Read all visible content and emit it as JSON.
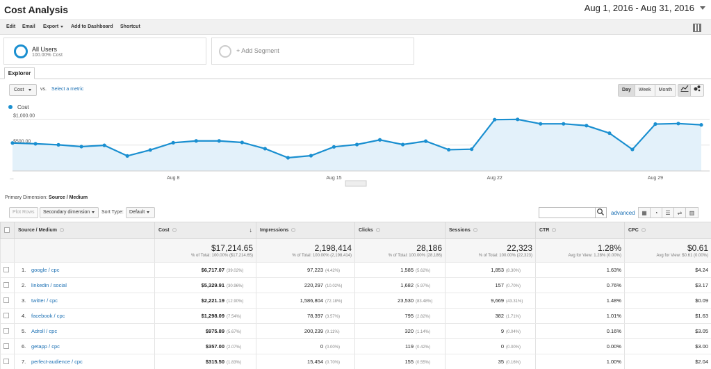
{
  "header": {
    "title": "Cost Analysis",
    "date_range": "Aug 1, 2016 - Aug 31, 2016"
  },
  "toolbar": {
    "edit": "Edit",
    "email": "Email",
    "export": "Export",
    "add_to_dashboard": "Add to Dashboard",
    "shortcut": "Shortcut"
  },
  "segments": {
    "all_users_name": "All Users",
    "all_users_sub": "100.00% Cost",
    "add_segment": "+ Add Segment"
  },
  "tabs": {
    "explorer": "Explorer"
  },
  "chart_controls": {
    "metric": "Cost",
    "vs": "vs.",
    "select_metric": "Select a metric",
    "time_buttons": [
      "Day",
      "Week",
      "Month"
    ],
    "active_time": "Day"
  },
  "chart_data": {
    "type": "area",
    "series": [
      {
        "name": "Cost",
        "values": [
          540,
          525,
          505,
          470,
          495,
          290,
          405,
          545,
          580,
          580,
          550,
          430,
          255,
          295,
          465,
          510,
          600,
          510,
          575,
          410,
          420,
          990,
          995,
          910,
          910,
          875,
          730,
          415,
          905,
          915,
          890
        ]
      }
    ],
    "x": [
      "Aug 1",
      "Aug 2",
      "Aug 3",
      "Aug 4",
      "Aug 5",
      "Aug 6",
      "Aug 7",
      "Aug 8",
      "Aug 9",
      "Aug 10",
      "Aug 11",
      "Aug 12",
      "Aug 13",
      "Aug 14",
      "Aug 15",
      "Aug 16",
      "Aug 17",
      "Aug 18",
      "Aug 19",
      "Aug 20",
      "Aug 21",
      "Aug 22",
      "Aug 23",
      "Aug 24",
      "Aug 25",
      "Aug 26",
      "Aug 27",
      "Aug 28",
      "Aug 29",
      "Aug 30",
      "Aug 31"
    ],
    "x_tick_labels": [
      "...",
      "Aug 8",
      "Aug 15",
      "Aug 22",
      "Aug 29"
    ],
    "y_tick_labels": [
      "$1,000.00",
      "$500.00"
    ],
    "ylim": [
      0,
      1100
    ],
    "color": "#1a8fd0",
    "fill": "#e3f1fa",
    "grid": true
  },
  "primary_dimension": {
    "label": "Primary Dimension:",
    "value": "Source / Medium"
  },
  "table_controls": {
    "plot_rows": "Plot Rows",
    "secondary_dimension": "Secondary dimension",
    "sort_type_label": "Sort Type:",
    "sort_type": "Default",
    "advanced": "advanced"
  },
  "table": {
    "headers": [
      "Source / Medium",
      "Cost",
      "Impressions",
      "Clicks",
      "Sessions",
      "CTR",
      "CPC"
    ],
    "totals": [
      {
        "big": "$17,214.65",
        "small": "% of Total: 100.00% ($17,214.65)"
      },
      {
        "big": "2,198,414",
        "small": "% of Total: 100.00% (2,198,414)"
      },
      {
        "big": "28,186",
        "small": "% of Total: 100.00% (28,186)"
      },
      {
        "big": "22,323",
        "small": "% of Total: 100.00% (22,323)"
      },
      {
        "big": "1.28%",
        "small": "Avg for View: 1.28% (0.00%)"
      },
      {
        "big": "$0.61",
        "small": "Avg for View: $0.61 (0.00%)"
      }
    ],
    "rows": [
      {
        "idx": "1.",
        "source": "google / cpc",
        "cost": "$6,717.07",
        "cost_pct": "(39.02%)",
        "impr": "97,223",
        "impr_pct": "(4.42%)",
        "clicks": "1,585",
        "clicks_pct": "(5.62%)",
        "sessions": "1,853",
        "sessions_pct": "(8.30%)",
        "ctr": "1.63%",
        "cpc": "$4.24"
      },
      {
        "idx": "2.",
        "source": "linkedin / social",
        "cost": "$5,329.91",
        "cost_pct": "(30.96%)",
        "impr": "220,297",
        "impr_pct": "(10.02%)",
        "clicks": "1,682",
        "clicks_pct": "(5.97%)",
        "sessions": "157",
        "sessions_pct": "(0.70%)",
        "ctr": "0.76%",
        "cpc": "$3.17"
      },
      {
        "idx": "3.",
        "source": "twitter / cpc",
        "cost": "$2,221.19",
        "cost_pct": "(12.90%)",
        "impr": "1,586,804",
        "impr_pct": "(72.18%)",
        "clicks": "23,530",
        "clicks_pct": "(83.48%)",
        "sessions": "9,669",
        "sessions_pct": "(43.31%)",
        "ctr": "1.48%",
        "cpc": "$0.09"
      },
      {
        "idx": "4.",
        "source": "facebook / cpc",
        "cost": "$1,298.09",
        "cost_pct": "(7.54%)",
        "impr": "78,397",
        "impr_pct": "(3.57%)",
        "clicks": "795",
        "clicks_pct": "(2.82%)",
        "sessions": "382",
        "sessions_pct": "(1.71%)",
        "ctr": "1.01%",
        "cpc": "$1.63"
      },
      {
        "idx": "5.",
        "source": "Adroll / cpc",
        "cost": "$975.89",
        "cost_pct": "(5.67%)",
        "impr": "200,239",
        "impr_pct": "(9.11%)",
        "clicks": "320",
        "clicks_pct": "(1.14%)",
        "sessions": "9",
        "sessions_pct": "(0.04%)",
        "ctr": "0.16%",
        "cpc": "$3.05"
      },
      {
        "idx": "6.",
        "source": "getapp / cpc",
        "cost": "$357.00",
        "cost_pct": "(2.07%)",
        "impr": "0",
        "impr_pct": "(0.00%)",
        "clicks": "119",
        "clicks_pct": "(0.42%)",
        "sessions": "0",
        "sessions_pct": "(0.00%)",
        "ctr": "0.00%",
        "cpc": "$3.00"
      },
      {
        "idx": "7.",
        "source": "perfect-audience / cpc",
        "cost": "$315.50",
        "cost_pct": "(1.83%)",
        "impr": "15,454",
        "impr_pct": "(0.70%)",
        "clicks": "155",
        "clicks_pct": "(0.55%)",
        "sessions": "35",
        "sessions_pct": "(0.16%)",
        "ctr": "1.00%",
        "cpc": "$2.04"
      }
    ]
  }
}
